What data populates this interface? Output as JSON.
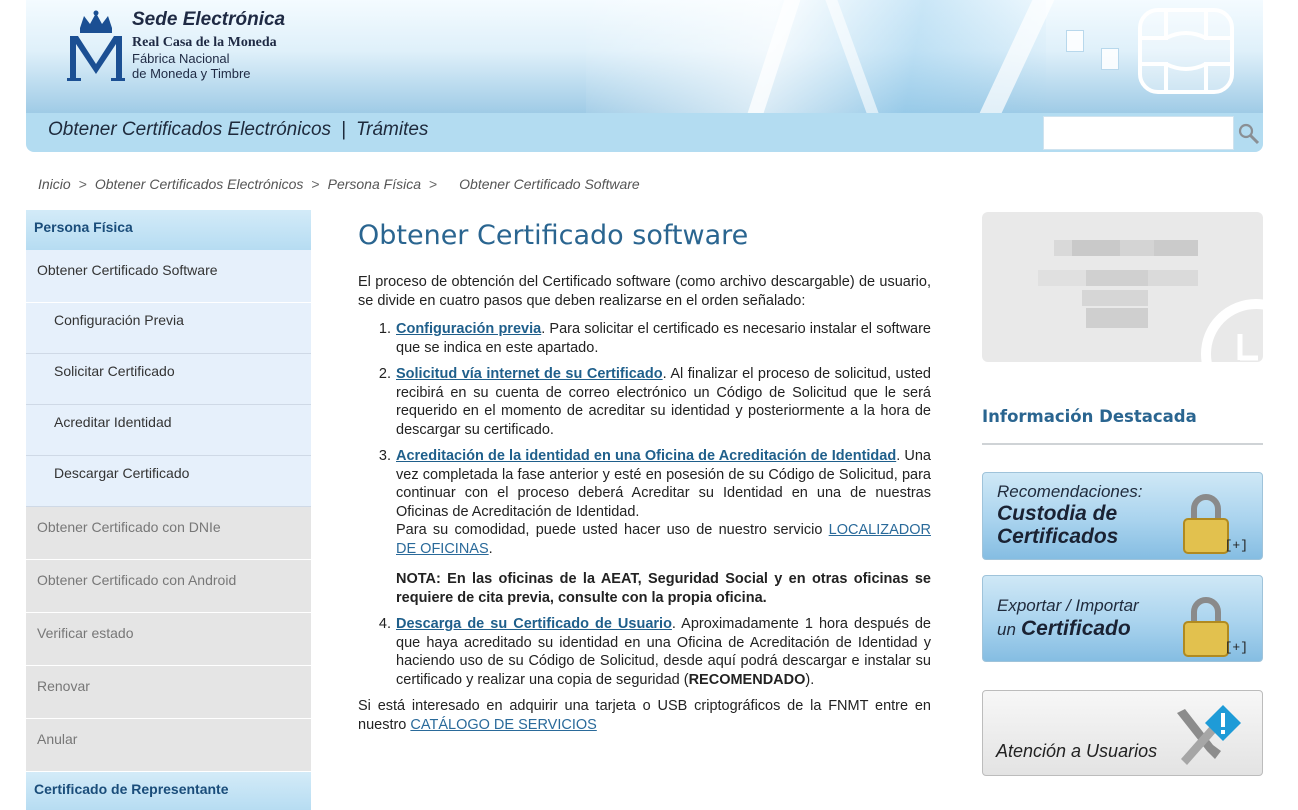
{
  "header": {
    "brand_title": "Sede Electrónica",
    "brand_line1": "Real Casa de la Moneda",
    "brand_line2": "Fábrica Nacional",
    "brand_line3": "de Moneda y Timbre",
    "logo_icon": "fnmt-crown-m-logo",
    "chip_icon": "smartcard-chip-icon"
  },
  "nav": {
    "link1": "Obtener Certificados Electrónicos",
    "separator": "|",
    "link2": "Trámites",
    "search_value": "",
    "search_icon": "search-icon"
  },
  "breadcrumb": {
    "items": [
      "Inicio",
      "Obtener Certificados Electrónicos",
      "Persona Física"
    ],
    "separator": ">",
    "current": "Obtener Certificado Software"
  },
  "sidebar": {
    "section_title": "Persona Física",
    "active_item": "Obtener Certificado Software",
    "sub_items": [
      "Configuración Previa",
      "Solicitar Certificado",
      "Acreditar Identidad",
      "Descargar Certificado"
    ],
    "other_items": [
      "Obtener Certificado con DNIe",
      "Obtener Certificado con Android",
      "Verificar estado",
      "Renovar",
      "Anular"
    ],
    "bottom_section": "Certificado de Representante"
  },
  "main": {
    "title": "Obtener Certificado software",
    "intro": "El proceso de obtención del Certificado software (como archivo descargable) de usuario, se divide en cuatro pasos que deben realizarse en el orden señalado:",
    "steps": [
      {
        "link": "Configuración previa",
        "text": ". Para solicitar el certificado es necesario instalar el software que se indica en este apartado."
      },
      {
        "link": "Solicitud vía internet de su Certificado",
        "text": ". Al finalizar el proceso de solicitud, usted recibirá en su cuenta de correo electrónico un Código de Solicitud que le será requerido en el momento de acreditar su identidad y posteriormente a la hora de descargar su certificado."
      },
      {
        "link": "Acreditación de la identidad en una Oficina de Acreditación de Identidad",
        "text": ". Una vez completada la fase anterior y esté en posesión de su Código de Solicitud, para continuar con el proceso deberá Acreditar su Identidad en una de nuestras Oficinas de Acreditación de Identidad.",
        "extra": "Para su comodidad, puede usted hacer uso de nuestro servicio ",
        "extra_link": "LOCALIZADOR DE OFICINAS",
        "extra_end": ".",
        "nota": "NOTA: En las oficinas de la AEAT, Seguridad Social y en otras oficinas se requiere de cita previa, consulte con la propia oficina."
      },
      {
        "link": "Descarga de su Certificado de Usuario",
        "text": ". Aproximadamente 1 hora después de que haya acreditado su identidad en una Oficina de Acreditación de Identidad y haciendo uso de su Código de Solicitud, desde aquí podrá descargar e instalar su certificado y realizar una copia de seguridad (",
        "bold": "RECOMENDADO",
        "end": ")."
      }
    ],
    "outro": "Si está interesado en adquirir una tarjeta o USB criptográficos de la FNMT entre en nuestro ",
    "outro_link": "CATÁLOGO DE SERVICIOS"
  },
  "right": {
    "info_title": "Información Destacada",
    "promo1_small": "Recomendaciones:",
    "promo1_big1": "Custodia de",
    "promo1_big2": "Certificados",
    "promo1_plus": "[+]",
    "promo2_small": "Exportar / Importar",
    "promo2_prefix": "un",
    "promo2_big": "Certificado",
    "promo2_plus": "[+]",
    "attn_label": "Atención a Usuarios",
    "padlock_icon": "padlock-icon",
    "tools_icon": "tools-info-icon",
    "colors": {
      "accent": "#2a6590",
      "nav_bg": "#b3dcf1",
      "sidebar_active": "#e6f0fb",
      "sidebar_grey": "#e5e5e5"
    }
  }
}
